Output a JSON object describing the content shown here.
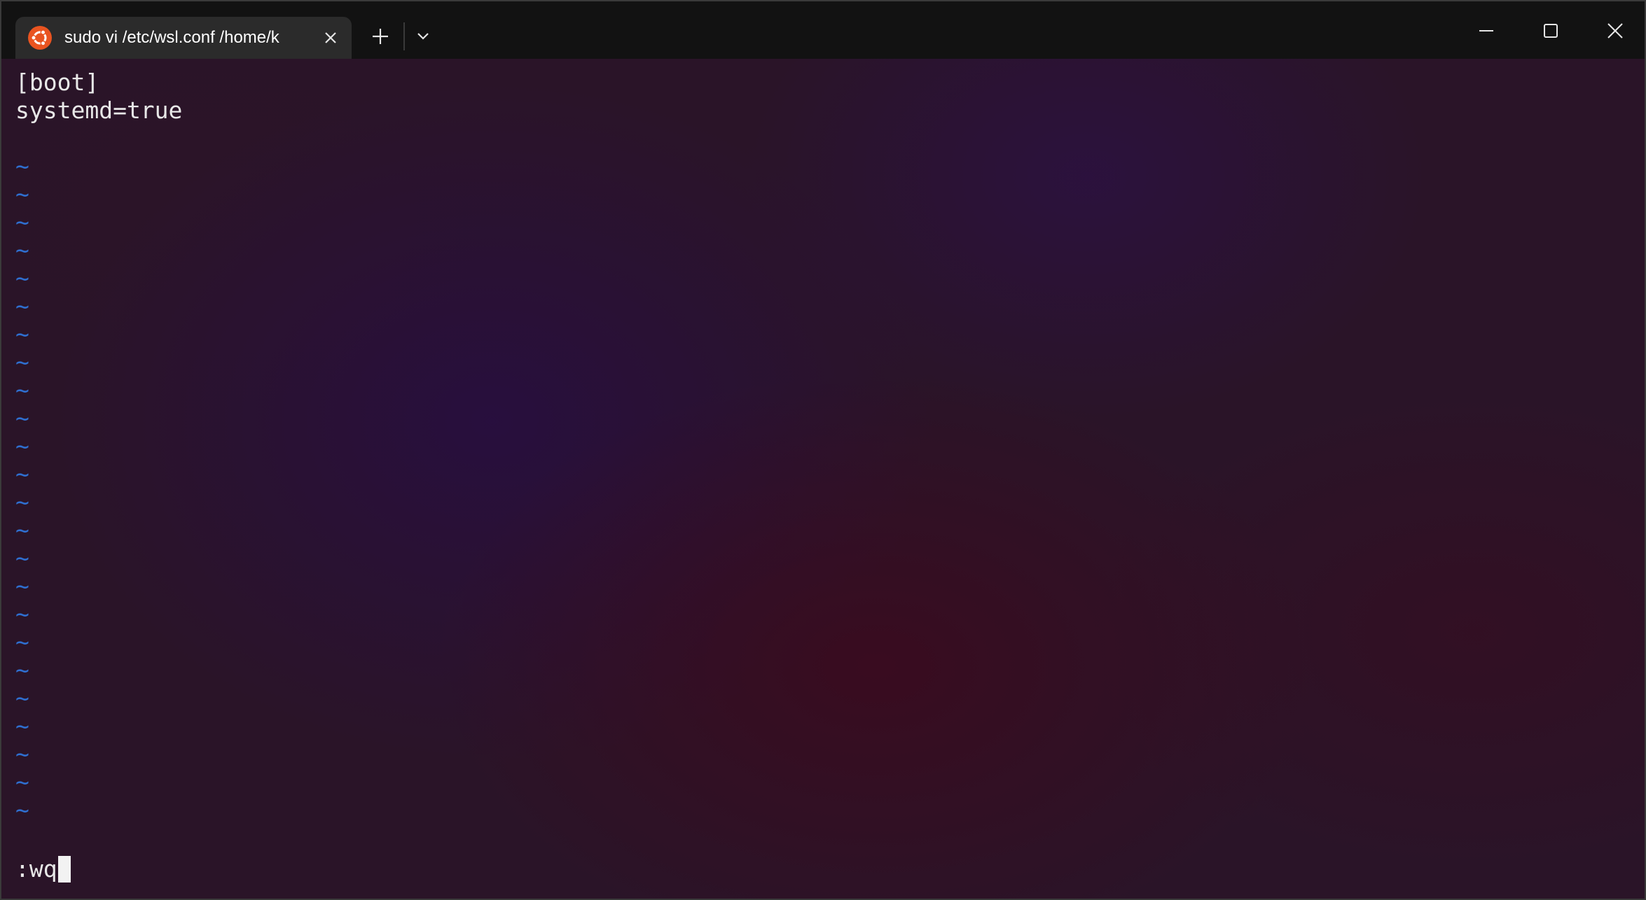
{
  "window": {
    "tab_title": "sudo vi /etc/wsl.conf /home/k",
    "accent_color": "#2b4fa0",
    "background_color": "#2a1428"
  },
  "icons": {
    "tab_icon": "ubuntu-logo-icon",
    "tab_close": "close-icon",
    "new_tab": "plus-icon",
    "dropdown": "chevron-down-icon",
    "minimize": "minimize-icon",
    "maximize": "maximize-icon",
    "close": "close-icon"
  },
  "editor": {
    "lines": [
      "[boot]",
      "systemd=true",
      ""
    ],
    "tilde_char": "~",
    "tilde_color": "#2f6fd0",
    "command": ":wq"
  }
}
